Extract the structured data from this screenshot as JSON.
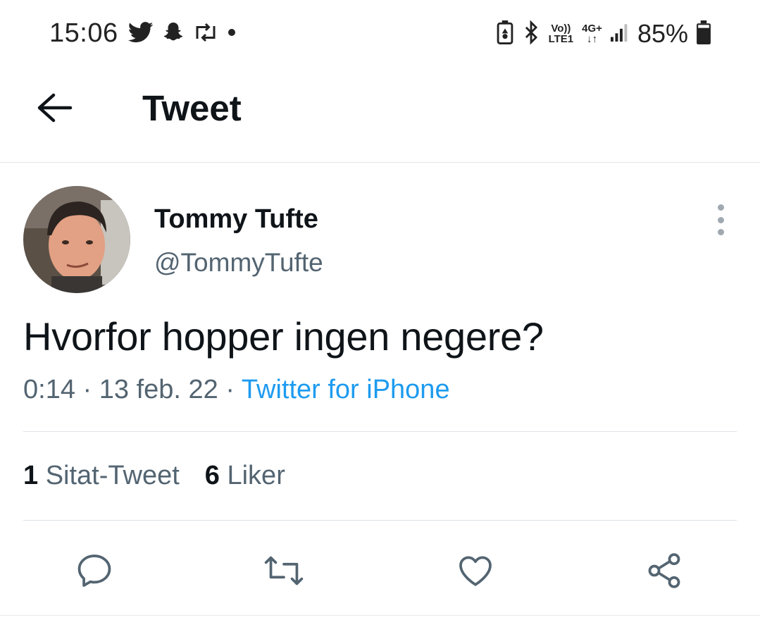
{
  "status_bar": {
    "time": "15:06",
    "network_top": "Vo))",
    "network_bottom": "LTE1",
    "data_top": "4G+",
    "battery_percent": "85%",
    "left_icons": [
      "twitter-icon",
      "snapchat-icon",
      "retweet-icon",
      "dot-icon"
    ],
    "right_icons": [
      "battery-saver-icon",
      "bluetooth-icon",
      "signal-icon",
      "battery-icon"
    ]
  },
  "header": {
    "title": "Tweet",
    "back_icon": "arrow-left-icon"
  },
  "tweet": {
    "author": {
      "display_name": "Tommy Tufte",
      "handle": "@TommyTufte"
    },
    "text": "Hvorfor hopper ingen negere?",
    "time": "0:14",
    "date": "13 feb. 22",
    "source": "Twitter for iPhone",
    "separator": "·"
  },
  "stats": {
    "quote_count": "1",
    "quote_label": "Sitat-Tweet",
    "like_count": "6",
    "like_label": "Liker"
  },
  "actions": [
    "reply-icon",
    "retweet-icon",
    "like-icon",
    "share-icon"
  ],
  "colors": {
    "link": "#1d9bf0",
    "secondary_text": "#536471",
    "primary_text": "#0f1419",
    "divider": "#dfe3e7"
  }
}
